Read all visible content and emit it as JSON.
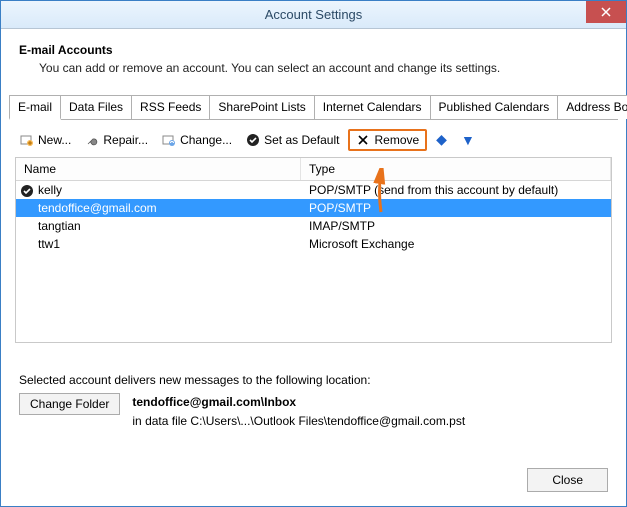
{
  "window": {
    "title": "Account Settings"
  },
  "header": {
    "title": "E-mail Accounts",
    "subtitle": "You can add or remove an account. You can select an account and change its settings."
  },
  "tabs": [
    {
      "id": "email",
      "label": "E-mail",
      "active": true
    },
    {
      "id": "data-files",
      "label": "Data Files"
    },
    {
      "id": "rss",
      "label": "RSS Feeds"
    },
    {
      "id": "sharepoint",
      "label": "SharePoint Lists"
    },
    {
      "id": "ical",
      "label": "Internet Calendars"
    },
    {
      "id": "pubcal",
      "label": "Published Calendars"
    },
    {
      "id": "addr",
      "label": "Address Books"
    }
  ],
  "toolbar": {
    "new": "New...",
    "repair": "Repair...",
    "change": "Change...",
    "default": "Set as Default",
    "remove": "Remove"
  },
  "list": {
    "columns": {
      "name": "Name",
      "type": "Type"
    },
    "rows": [
      {
        "name": "kelly",
        "type": "POP/SMTP (send from this account by default)",
        "default": true,
        "selected": false
      },
      {
        "name": "tendoffice@gmail.com",
        "type": "POP/SMTP",
        "default": false,
        "selected": true
      },
      {
        "name": "tangtian",
        "type": "IMAP/SMTP",
        "default": false,
        "selected": false
      },
      {
        "name": "ttw1",
        "type": "Microsoft Exchange",
        "default": false,
        "selected": false
      }
    ]
  },
  "delivery": {
    "intro": "Selected account delivers new messages to the following location:",
    "change_folder": "Change Folder",
    "folder": "tendoffice@gmail.com\\Inbox",
    "file": "in data file C:\\Users\\...\\Outlook Files\\tendoffice@gmail.com.pst"
  },
  "footer": {
    "close": "Close"
  }
}
